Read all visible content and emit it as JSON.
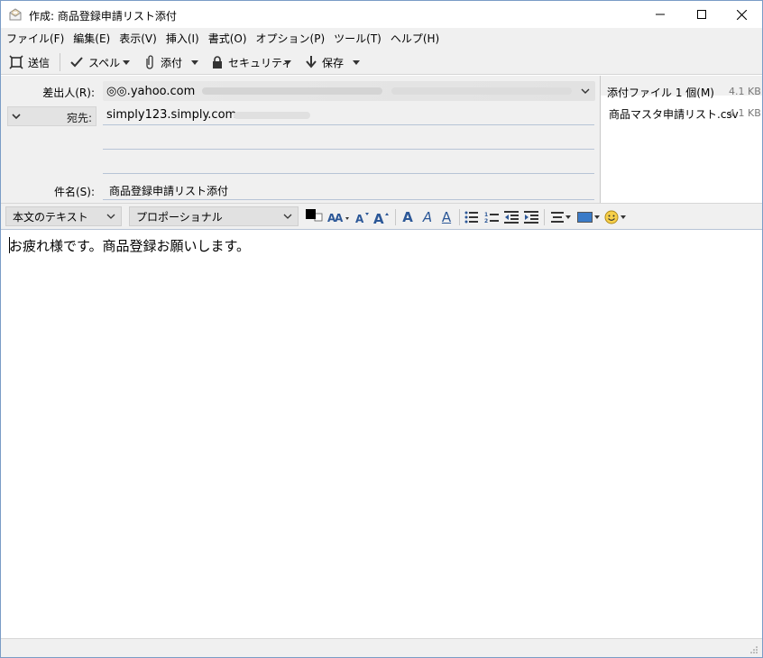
{
  "window": {
    "title": "作成: 商品登録申請リスト添付",
    "controls": {
      "minimize": "—",
      "maximize": "☐",
      "close": "✕"
    }
  },
  "menu": [
    "ファイル(F)",
    "編集(E)",
    "表示(V)",
    "挿入(I)",
    "書式(O)",
    "オプション(P)",
    "ツール(T)",
    "ヘルプ(H)"
  ],
  "toolbar": {
    "send_label": "送信",
    "spell_label": "スペル",
    "attach_label": "添付",
    "security_label": "セキュリティ",
    "save_label": "保存"
  },
  "header": {
    "from_label": "差出人(R):",
    "from_value": "◎◎.yahoo.com",
    "to_label": "宛先:",
    "to_value": "simply123.simply.com",
    "subject_label": "件名(S):",
    "subject_value": "商品登録申請リスト添付"
  },
  "attachments": {
    "header_label": "添付ファイル 1 個(M)",
    "header_size": "4.1 KB",
    "items": [
      {
        "name": "商品マスタ申請リスト.csv",
        "size": "4.1 KB"
      }
    ]
  },
  "format": {
    "paragraph_style": "本文のテキスト",
    "font": "プロポーショナル",
    "text_color": "#000000",
    "bold_label": "A",
    "italic_label": "A",
    "underline_label": "A"
  },
  "body": {
    "text": "お疲れ様です。商品登録お願いします。"
  }
}
